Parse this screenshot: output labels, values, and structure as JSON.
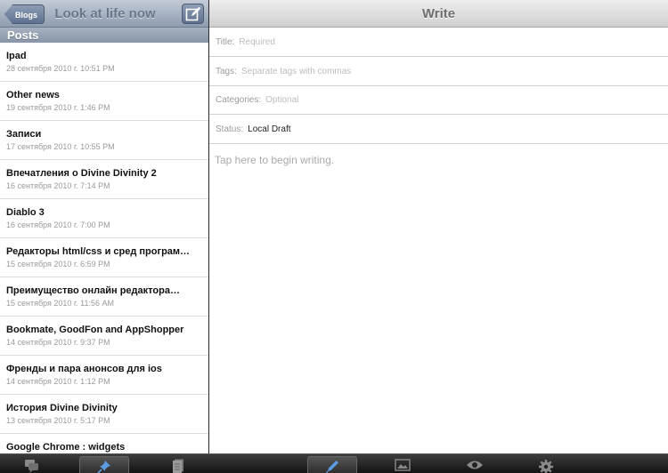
{
  "left_pane": {
    "back_button": "Blogs",
    "title": "Look at life now",
    "section_header": "Posts",
    "posts": [
      {
        "title": "Ipad",
        "date": "28 сентября 2010 г. 10:51 PM"
      },
      {
        "title": "Other news",
        "date": "19 сентября 2010 г. 1:46 PM"
      },
      {
        "title": "Записи",
        "date": "17 сентября 2010 г. 10:55 PM"
      },
      {
        "title": "Впечатления о Divine Divinity 2",
        "date": "16 сентября 2010 г. 7:14 PM"
      },
      {
        "title": "Diablo 3",
        "date": "16 сентября 2010 г. 7:00 PM"
      },
      {
        "title": "Редакторы html/css и сред програм…",
        "date": "15 сентября 2010 г. 6:59 PM"
      },
      {
        "title": "Преимущество онлайн редактора…",
        "date": "15 сентября 2010 г. 11:56 AM"
      },
      {
        "title": "Bookmate, GoodFon and AppShopper",
        "date": "14 сентября 2010 г. 9:37 PM"
      },
      {
        "title": "Френды и пара анонсов для ios",
        "date": "14 сентября 2010 г. 1:12 PM"
      },
      {
        "title": "История Divine Divinity",
        "date": "13 сентября 2010 г. 5:17 PM"
      },
      {
        "title": "Google Chrome : widgets",
        "date": ""
      }
    ]
  },
  "right_pane": {
    "title": "Write",
    "fields": {
      "title_label": "Title:",
      "title_placeholder": "Required",
      "tags_label": "Tags:",
      "tags_placeholder": "Separate tags with commas",
      "categories_label": "Categories:",
      "categories_placeholder": "Optional",
      "status_label": "Status:",
      "status_value": "Local Draft"
    },
    "body_placeholder": "Tap here to begin writing."
  },
  "toolbar": {
    "icons": [
      "comments-icon",
      "pin-icon",
      "pages-icon",
      "pencil-icon",
      "photo-icon",
      "preview-eye-icon",
      "settings-gear-icon"
    ],
    "active": [
      "pin-icon",
      "pencil-icon"
    ]
  },
  "colors": {
    "left_nav": "#8e9cb0",
    "section_header": "#8896a8",
    "right_nav": "#cfcfcf",
    "toolbar": "#1e1e1e"
  }
}
